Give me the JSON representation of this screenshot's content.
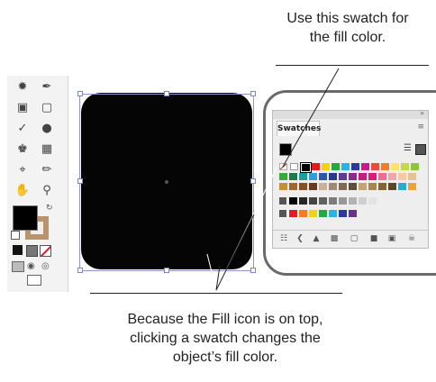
{
  "callouts": {
    "top": [
      "Use this swatch for",
      "the fill color."
    ],
    "bottom": [
      "Because the Fill icon is on top,",
      "clicking a swatch changes the",
      "object’s fill color."
    ]
  },
  "swatches_panel": {
    "tab_label": "Swatches",
    "view_icons": [
      "list-view-icon",
      "grid-view-icon"
    ]
  },
  "tools": [
    "lasso-icon",
    "pen-icon",
    "artboard-icon",
    "rectangle-icon",
    "eyedropper-icon",
    "blend-icon",
    "symbol-sprayer-icon",
    "column-graph-icon",
    "crop-icon",
    "pencil-icon",
    "hand-icon",
    "zoom-icon"
  ],
  "colors": {
    "fill": "#000000",
    "stroke": "#b8946e",
    "object": "#050505",
    "selection": "#7b84c6"
  }
}
